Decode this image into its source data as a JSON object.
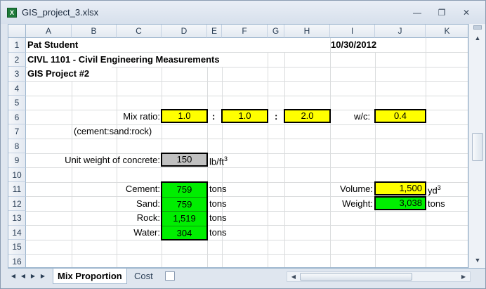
{
  "window": {
    "title": "GIS_project_3.xlsx",
    "app_icon_letter": "X"
  },
  "columns": [
    "A",
    "B",
    "C",
    "D",
    "E",
    "F",
    "G",
    "H",
    "I",
    "J",
    "K"
  ],
  "rows": [
    "1",
    "2",
    "3",
    "4",
    "5",
    "6",
    "7",
    "8",
    "9",
    "10",
    "11",
    "12",
    "13",
    "14",
    "15",
    "16"
  ],
  "header": {
    "name": "Pat Student",
    "date": "10/30/2012",
    "course": "CIVL 1101 - Civil Engineering Measurements",
    "project": "GIS Project #2"
  },
  "mix": {
    "label": "Mix ratio:",
    "cement": "1.0",
    "sep1": ":",
    "sand": "1.0",
    "sep2": ":",
    "rock": "2.0",
    "note": "(cement:sand:rock)",
    "wc_label": "w/c:",
    "wc": "0.4"
  },
  "unit_weight": {
    "label": "Unit weight of concrete:",
    "value": "150",
    "unit": "lb/ft",
    "unit_sup": "3"
  },
  "materials": [
    {
      "label": "Cement:",
      "value": "759",
      "unit": "tons"
    },
    {
      "label": "Sand:",
      "value": "759",
      "unit": "tons"
    },
    {
      "label": "Rock:",
      "value": "1,519",
      "unit": "tons"
    },
    {
      "label": "Water:",
      "value": "304",
      "unit": "tons"
    }
  ],
  "volume": {
    "label": "Volume:",
    "value": "1,500",
    "unit": "yd",
    "unit_sup": "3"
  },
  "weight": {
    "label": "Weight:",
    "value": "3,038",
    "unit": "tons"
  },
  "sheet_tabs": {
    "active": "Mix Proportion",
    "other": "Cost"
  },
  "colors": {
    "input": "#ffff00",
    "output": "#00ee00",
    "fixed": "#c0c0c0"
  }
}
